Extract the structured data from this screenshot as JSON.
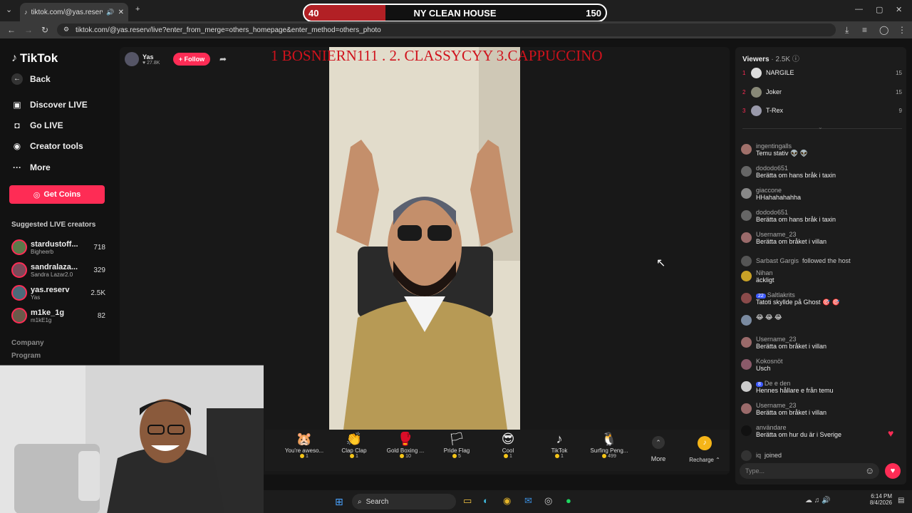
{
  "browser": {
    "tab_title": "tiktok.com/@yas.reserv/live",
    "url": "tiktok.com/@yas.reserv/live?enter_from_merge=others_homepage&enter_method=others_photo"
  },
  "battle": {
    "left_score": "40",
    "title": "NY CLEAN HOUSE",
    "right_score": "150",
    "left_fraction": 0.27
  },
  "ranking_text": "1 BOSNIERN111 .  2. CLASSYCYY  3.CAPPUCCINO",
  "sidebar": {
    "logo": "TikTok",
    "back": "Back",
    "nav": [
      "Discover LIVE",
      "Go LIVE",
      "Creator tools",
      "More"
    ],
    "get_coins": "Get Coins",
    "suggested_title": "Suggested LIVE creators",
    "creators": [
      {
        "name": "stardustoff...",
        "sub": "Bigheerb",
        "count": "718",
        "color": "#5a7a4a"
      },
      {
        "name": "sandralaza...",
        "sub": "Sandra Lazar2.0",
        "count": "329",
        "color": "#7a4a5a"
      },
      {
        "name": "yas.reserv",
        "sub": "Yas",
        "count": "2.5K",
        "color": "#4a6a7a"
      },
      {
        "name": "m1ke_1g",
        "sub": "m1kE1g",
        "count": "82",
        "color": "#6a5a4a"
      }
    ],
    "footer": [
      "Company",
      "Program"
    ]
  },
  "host": {
    "name": "Yas",
    "likes": "27.8K",
    "follow": "+ Follow"
  },
  "gifts": [
    {
      "name": "You're aweso...",
      "price": "1",
      "icon": "🐹"
    },
    {
      "name": "Clap Clap",
      "price": "1",
      "icon": "👏"
    },
    {
      "name": "Gold Boxing ...",
      "price": "10",
      "icon": "🥊"
    },
    {
      "name": "Pride Flag",
      "price": "5",
      "icon": "🏳"
    },
    {
      "name": "Cool",
      "price": "1",
      "icon": "😎"
    },
    {
      "name": "TikTok",
      "price": "1",
      "icon": "♪"
    },
    {
      "name": "Surfing Peng...",
      "price": "499",
      "icon": "🐧"
    }
  ],
  "gift_more": "More",
  "recharge": "Recharge",
  "viewers": {
    "title": "Viewers",
    "count": "2.5K",
    "list": [
      {
        "rank": "1",
        "name": "NARGILE",
        "count": "15"
      },
      {
        "rank": "2",
        "name": "Joker",
        "count": "15"
      },
      {
        "rank": "3",
        "name": "T-Rex",
        "count": "9"
      }
    ]
  },
  "chat": [
    {
      "user": "ingentingalls",
      "text": "Temu stativ 👽 👽",
      "color": "#a0706a"
    },
    {
      "user": "dododo651",
      "text": "Berätta om hans bråk i taxin",
      "color": "#666"
    },
    {
      "user": "giaccone",
      "text": "HHahahahahha",
      "color": "#888"
    },
    {
      "user": "dododo651",
      "text": "Berätta om hans bråk i taxin",
      "color": "#666"
    },
    {
      "user": "Username_23",
      "text": "Berätta om bråket i villan",
      "color": "#9a6a6a"
    },
    {
      "user": "Sarbast Gargis",
      "text": "followed the host",
      "color": "#555"
    },
    {
      "user": "Nihan",
      "text": "äckligt",
      "color": "#c9a227"
    },
    {
      "user": "Saltlakrits",
      "text": "Tatoti skyllde på Ghost 🎯 🎯",
      "color": "#8a4a4a",
      "badge": "22"
    },
    {
      "user": "",
      "text": "😂 😂 😂",
      "color": "#7a8aa0"
    },
    {
      "user": "Username_23",
      "text": "Berätta om bråket i villan",
      "color": "#9a6a6a"
    },
    {
      "user": "Kokosnöt",
      "text": "Usch",
      "color": "#8a5a6a"
    },
    {
      "user": "De e den",
      "text": "Hennes hållare e från temu",
      "color": "#ccc",
      "badge": "8"
    },
    {
      "user": "Username_23",
      "text": "Berätta om bråket i villan",
      "color": "#9a6a6a"
    },
    {
      "user": "användare",
      "text": "Berätta om hur du är i Sverige",
      "color": "#111"
    },
    {
      "user": "iq",
      "text": "joined",
      "color": "#333"
    }
  ],
  "chat_placeholder": "Type...",
  "taskbar": {
    "search": "Search",
    "time": "6:14 PM",
    "date": "8/4/2026"
  }
}
